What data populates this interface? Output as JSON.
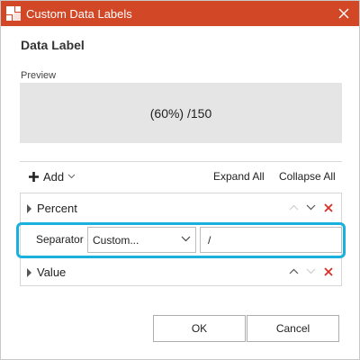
{
  "window": {
    "title": "Custom Data Labels",
    "title_bar_color": "#d24726",
    "app_icon": "chart-app-icon",
    "close_icon": "close-icon"
  },
  "heading": "Data Label",
  "preview": {
    "label": "Preview",
    "text": "(60%) /150"
  },
  "toolbar": {
    "add_label": "Add",
    "expand_all_label": "Expand All",
    "collapse_all_label": "Collapse All"
  },
  "items": [
    {
      "label": "Percent",
      "expanded": false,
      "move_up_enabled": false,
      "move_down_enabled": true
    },
    {
      "label": "Value",
      "expanded": false,
      "move_up_enabled": true,
      "move_down_enabled": false
    }
  ],
  "separator": {
    "label": "Separator",
    "mode": "Custom...",
    "value": "/",
    "highlight_color": "#1ab0de"
  },
  "footer": {
    "ok_label": "OK",
    "cancel_label": "Cancel"
  },
  "colors": {
    "delete": "#d93025",
    "preview_bg": "#e5e5e5"
  }
}
